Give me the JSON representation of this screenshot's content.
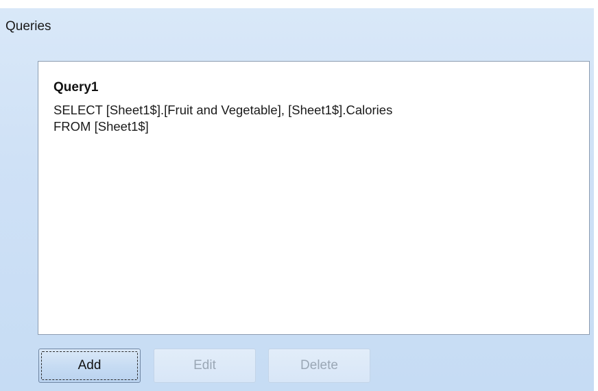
{
  "section": {
    "title": "Queries"
  },
  "queries": [
    {
      "name": "Query1",
      "sql_lines": [
        "SELECT [Sheet1$].[Fruit and Vegetable], [Sheet1$].Calories",
        "FROM [Sheet1$]"
      ]
    }
  ],
  "buttons": {
    "add": "Add",
    "edit": "Edit",
    "delete": "Delete"
  },
  "state": {
    "add_focused": true,
    "edit_enabled": false,
    "delete_enabled": false
  }
}
